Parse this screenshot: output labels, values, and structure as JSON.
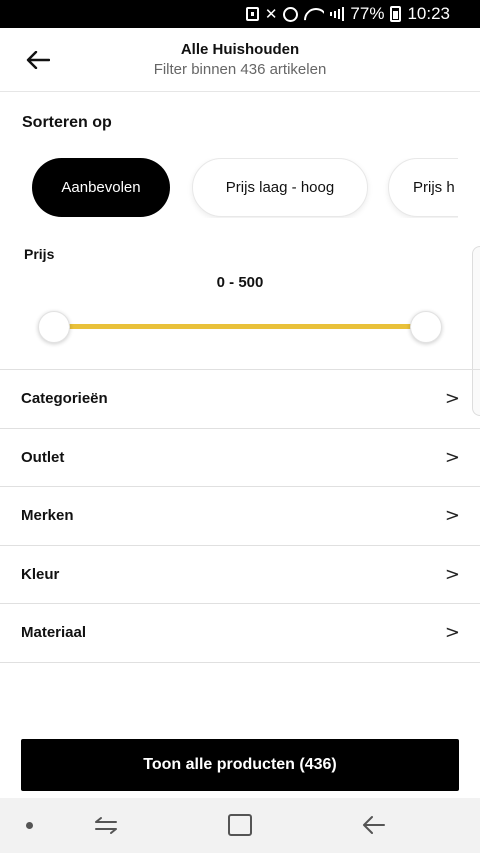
{
  "status_bar": {
    "battery_pct": "77%",
    "time": "10:23",
    "icons": [
      "notification-icon",
      "mute-icon",
      "alarm-icon",
      "wifi-icon",
      "signal-icon",
      "battery-icon"
    ]
  },
  "header": {
    "title": "Alle Huishouden",
    "subtitle": "Filter binnen 436 artikelen",
    "back_icon": "arrow-left-icon"
  },
  "sort": {
    "title": "Sorteren op",
    "options": [
      "Aanbevolen",
      "Prijs laag - hoog",
      "Prijs h"
    ],
    "selected": "Aanbevolen"
  },
  "price": {
    "label": "Prijs",
    "range_text": "0 - 500",
    "min": 0,
    "max": 500,
    "selected_min": 0,
    "selected_max": 500,
    "accent_color": "#e9c13a"
  },
  "filters": [
    {
      "label": "Categorieën",
      "chevron": ">"
    },
    {
      "label": "Outlet",
      "chevron": ">"
    },
    {
      "label": "Merken",
      "chevron": ">"
    },
    {
      "label": "Kleur",
      "chevron": ">"
    },
    {
      "label": "Materiaal",
      "chevron": ">"
    }
  ],
  "show_button": {
    "label": "Toon alle producten (436)"
  },
  "nav_bar": {
    "icons": [
      "dot-icon",
      "recent-apps-icon",
      "home-icon",
      "back-icon"
    ]
  }
}
